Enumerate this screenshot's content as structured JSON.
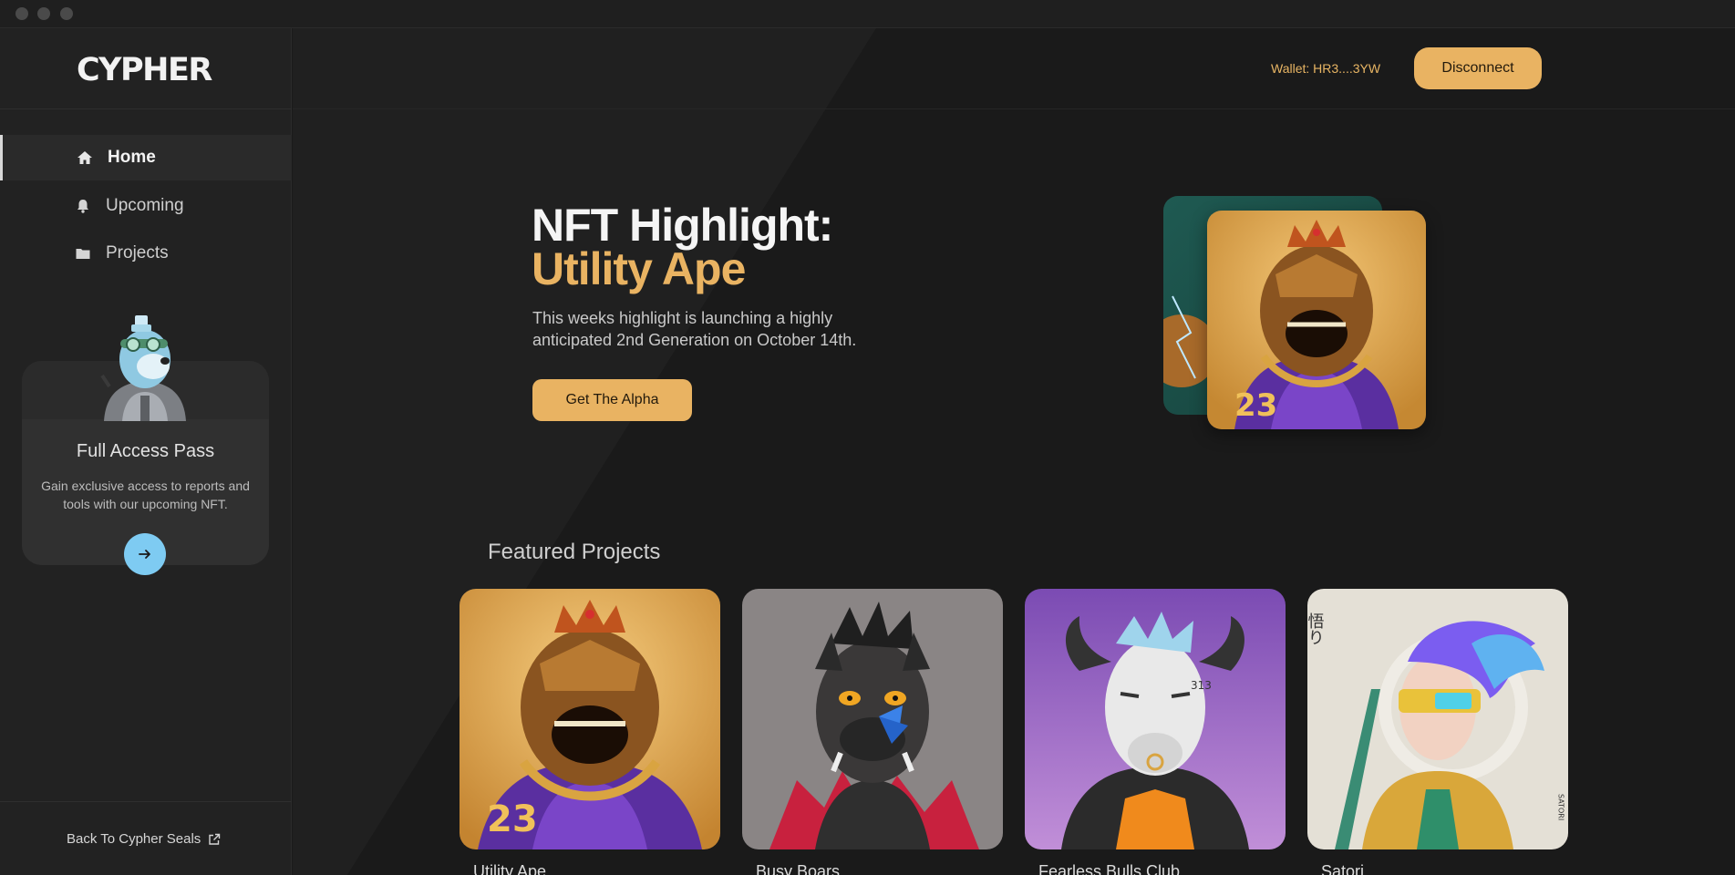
{
  "app": {
    "logo": "CYPHER"
  },
  "sidebar": {
    "items": [
      {
        "label": "Home",
        "icon": "home-icon",
        "active": true
      },
      {
        "label": "Upcoming",
        "icon": "bell-icon",
        "active": false
      },
      {
        "label": "Projects",
        "icon": "folder-icon",
        "active": false
      }
    ],
    "pass": {
      "title": "Full Access Pass",
      "description": "Gain exclusive access to reports and tools with our upcoming NFT."
    },
    "back_link": "Back To Cypher Seals"
  },
  "header": {
    "wallet": "Wallet: HR3....3YW",
    "disconnect": "Disconnect"
  },
  "hero": {
    "title": "NFT Highlight:",
    "accent": "Utility Ape",
    "description": "This weeks highlight is launching a highly anticipated 2nd Generation on October 14th.",
    "cta": "Get The Alpha"
  },
  "featured": {
    "title": "Featured Projects",
    "projects": [
      {
        "name": "Utility Ape"
      },
      {
        "name": "Busy Boars"
      },
      {
        "name": "Fearless Bulls Club"
      },
      {
        "name": "Satori"
      }
    ]
  },
  "art_text": {
    "jersey_number": "23",
    "bull_tag": "313",
    "satori_kanji": "悟り",
    "satori_vertical": "SATORI"
  },
  "colors": {
    "accent": "#e9b362",
    "background": "#1b1b1b",
    "sidebar": "#222222",
    "pass_button": "#7ecbf2"
  }
}
